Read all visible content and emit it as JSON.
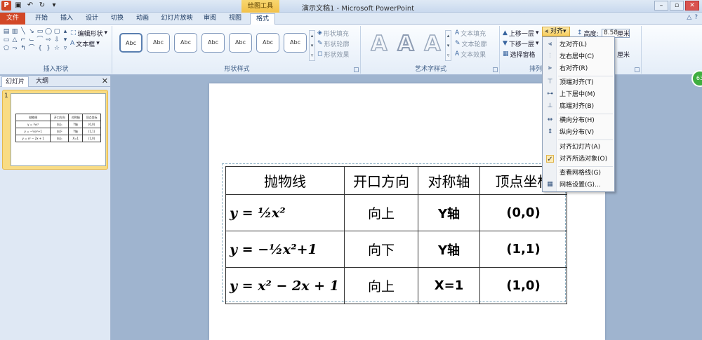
{
  "window": {
    "title": "演示文稿1 - Microsoft PowerPoint",
    "context_tab_group": "绘图工具",
    "app_logo": "P"
  },
  "tabs": [
    {
      "label": "文件"
    },
    {
      "label": "开始"
    },
    {
      "label": "插入"
    },
    {
      "label": "设计"
    },
    {
      "label": "切换"
    },
    {
      "label": "动画"
    },
    {
      "label": "幻灯片放映"
    },
    {
      "label": "审阅"
    },
    {
      "label": "视图"
    },
    {
      "label": "格式"
    }
  ],
  "ribbon": {
    "insert_shapes": {
      "label": "插入形状",
      "edit_shape": "编辑形状",
      "text_box": "文本框"
    },
    "shape_styles": {
      "label": "形状样式",
      "swatch_text": "Abc",
      "fill": "形状填充",
      "outline": "形状轮廓",
      "effects": "形状效果"
    },
    "wordart": {
      "label": "艺术字样式",
      "letter": "A",
      "text_fill": "文本填充",
      "text_outline": "文本轮廓",
      "text_effects": "文本效果"
    },
    "arrange": {
      "label": "排列",
      "bring_forward": "上移一层",
      "send_backward": "下移一层",
      "selection_pane": "选择窗格",
      "align": "对齐"
    },
    "size": {
      "height_label": "高度:",
      "height_value": "8.58",
      "width_unit": "厘米",
      "unit2": "厘米",
      "unit3": "厘米"
    }
  },
  "align_menu": {
    "items": [
      {
        "label": "左对齐(L)",
        "icon": "align-left-icon"
      },
      {
        "label": "左右居中(C)",
        "icon": "align-center-icon"
      },
      {
        "label": "右对齐(R)",
        "icon": "align-right-icon"
      },
      {
        "label": "顶端对齐(T)",
        "icon": "align-top-icon"
      },
      {
        "label": "上下居中(M)",
        "icon": "align-middle-icon"
      },
      {
        "label": "底端对齐(B)",
        "icon": "align-bottom-icon"
      },
      {
        "label": "横向分布(H)",
        "icon": "distribute-horizontal-icon"
      },
      {
        "label": "纵向分布(V)",
        "icon": "distribute-vertical-icon"
      },
      {
        "label": "对齐幻灯片(A)",
        "icon": ""
      },
      {
        "label": "对齐所选对象(O)",
        "icon": "checkmark-icon",
        "checked": true
      },
      {
        "label": "查看网格线(G)",
        "icon": "gridlines-icon"
      },
      {
        "label": "网格设置(G)...",
        "icon": "grid-settings-icon"
      }
    ]
  },
  "left_pane": {
    "tab_slides": "幻灯片",
    "tab_outline": "大纲",
    "slide_number": "1"
  },
  "table": {
    "headers": [
      "抛物线",
      "开口方向",
      "对称轴",
      "顶点坐标"
    ],
    "rows": [
      {
        "eq": "y = ½x²",
        "dir": "向上",
        "axis": "Y轴",
        "vertex": "(0,0)"
      },
      {
        "eq": "y = −½x²+1",
        "dir": "向下",
        "axis": "Y轴",
        "vertex": "(1,1)"
      },
      {
        "eq": "y = x² − 2x + 1",
        "dir": "向上",
        "axis": "X=1",
        "vertex": "(1,0)"
      }
    ]
  },
  "badge": {
    "text": "63"
  }
}
